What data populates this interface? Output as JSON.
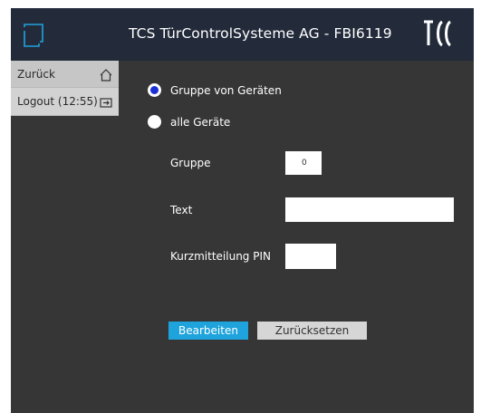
{
  "header": {
    "title": "TCS TürControlSysteme AG - FBI6119"
  },
  "sidebar": {
    "items": [
      {
        "label": "Zurück",
        "icon": "home-icon"
      },
      {
        "label": "Logout (12:55)",
        "icon": "logout-icon"
      }
    ]
  },
  "form": {
    "radio_options": [
      {
        "label": "Gruppe von Geräten",
        "selected": true
      },
      {
        "label": "alle Geräte",
        "selected": false
      }
    ],
    "gruppe": {
      "label": "Gruppe",
      "value": "0"
    },
    "text": {
      "label": "Text",
      "value": ""
    },
    "pin": {
      "label": "Kurzmitteilung PIN",
      "value": ""
    }
  },
  "buttons": {
    "edit_label": "Bearbeiten",
    "reset_label": "Zurücksetzen"
  },
  "colors": {
    "header_bg": "#232b3b",
    "content_bg": "#363636",
    "accent": "#1fa3dc",
    "radio_selected": "#1b2fd6"
  }
}
